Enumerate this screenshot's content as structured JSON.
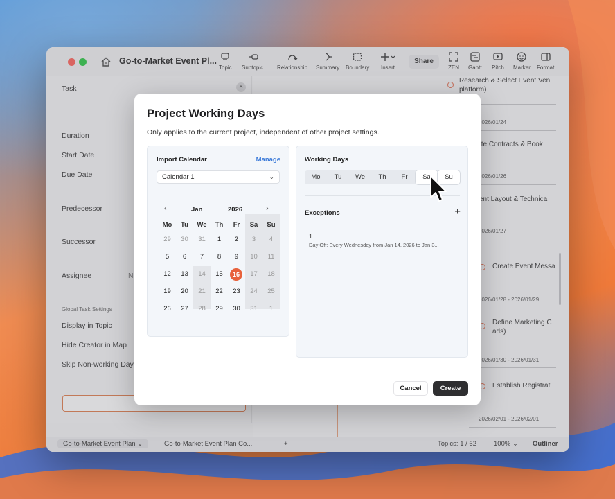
{
  "window": {
    "doc_title": "Go-to-Market Event Pl...",
    "share": "Share",
    "toolbar": [
      {
        "label": "Topic",
        "icon": "topic-icon"
      },
      {
        "label": "Subtopic",
        "icon": "subtopic-icon"
      },
      {
        "label": "Relationship",
        "icon": "relationship-icon"
      },
      {
        "label": "Summary",
        "icon": "summary-icon"
      },
      {
        "label": "Boundary",
        "icon": "boundary-icon"
      },
      {
        "label": "Insert",
        "icon": "insert-icon"
      },
      {
        "label": "ZEN",
        "icon": "zen-icon"
      },
      {
        "label": "Gantt",
        "icon": "gantt-icon"
      },
      {
        "label": "Pitch",
        "icon": "pitch-icon"
      },
      {
        "label": "Marker",
        "icon": "marker-icon"
      },
      {
        "label": "Format",
        "icon": "format-icon"
      }
    ]
  },
  "inspector": {
    "tab": "Task",
    "fields": [
      "Duration",
      "Start Date",
      "Due Date",
      "Predecessor",
      "Successor",
      "Assignee"
    ],
    "assignee_placeholder": "Na",
    "section": "Global Task Settings",
    "settings": [
      "Display in Topic",
      "Hide Creator in Map",
      "Skip Non-working Days"
    ]
  },
  "canvas": {
    "nodes": [
      {
        "text": "Research & Select Event Ven",
        "text2": "platform)"
      },
      {
        "date": "2026/01/24"
      },
      {
        "text": "iate Contracts & Book"
      },
      {
        "date": "2026/01/26"
      },
      {
        "text": "vent Layout & Technica"
      },
      {
        "date": "2026/01/27"
      },
      {
        "text": "Create Event Messa"
      },
      {
        "date": "2026/01/28 - 2026/01/29"
      },
      {
        "text": "Define Marketing C",
        "text2": "ads)"
      },
      {
        "date": "2026/01/30 - 2026/01/31"
      },
      {
        "text": "Establish Registrati"
      },
      {
        "date": "2026/02/01 - 2026/02/01"
      }
    ]
  },
  "bottombar": {
    "tab1": "Go-to-Market Event Plan",
    "tab2": "Go-to-Market Event Plan Co...",
    "add": "+",
    "topics": "Topics: 1 / 62",
    "zoom": "100%",
    "outliner": "Outliner"
  },
  "dialog": {
    "title": "Project Working Days",
    "subtitle": "Only applies to the current project, independent of other project settings.",
    "import_calendar": {
      "title": "Import Calendar",
      "manage": "Manage",
      "selected": "Calendar 1",
      "month": "Jan",
      "year": "2026",
      "weekdays": [
        "Mo",
        "Tu",
        "We",
        "Th",
        "Fr",
        "Sa",
        "Su"
      ],
      "weeks": [
        [
          "29",
          "30",
          "31",
          "1",
          "2",
          "3",
          "4"
        ],
        [
          "5",
          "6",
          "7",
          "8",
          "9",
          "10",
          "11"
        ],
        [
          "12",
          "13",
          "14",
          "15",
          "16",
          "17",
          "18"
        ],
        [
          "19",
          "20",
          "21",
          "22",
          "23",
          "24",
          "25"
        ],
        [
          "26",
          "27",
          "28",
          "29",
          "30",
          "31",
          "1"
        ]
      ],
      "today": "16"
    },
    "working_days": {
      "title": "Working Days",
      "days": [
        "Mo",
        "Tu",
        "We",
        "Th",
        "Fr",
        "Sa",
        "Su"
      ],
      "exceptions_title": "Exceptions",
      "add": "+",
      "exceptions": [
        {
          "index": "1",
          "description": "Day Off: Every Wednesday from Jan 14, 2026 to Jan 3..."
        }
      ]
    },
    "cancel": "Cancel",
    "create": "Create"
  }
}
